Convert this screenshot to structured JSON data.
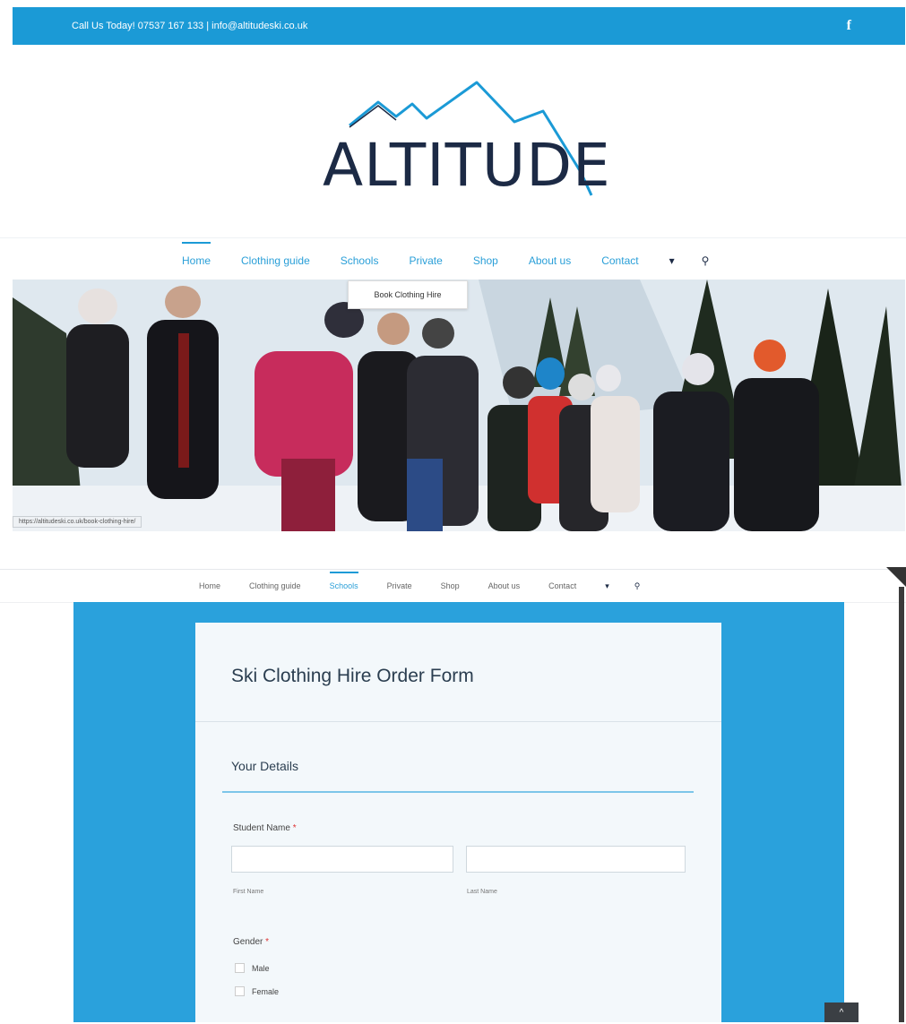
{
  "topbar": {
    "contact_text": "Call Us Today! 07537 167 133 | info@altitudeski.co.uk",
    "facebook_icon": "f"
  },
  "logo": {
    "text": "ALTITUDE"
  },
  "nav": {
    "items": [
      "Home",
      "Clothing guide",
      "Schools",
      "Private",
      "Shop",
      "About us",
      "Contact"
    ],
    "cart_icon": "▾",
    "search_icon": "⚲"
  },
  "dropdown": {
    "item": "Book Clothing Hire"
  },
  "hero": {
    "status_url": "https://altitudeski.co.uk/book-clothing-hire/"
  },
  "nav2": {
    "items": [
      "Home",
      "Clothing guide",
      "Schools",
      "Private",
      "Shop",
      "About us",
      "Contact"
    ],
    "cart_icon": "▾",
    "search_icon": "⚲"
  },
  "form": {
    "title": "Ski Clothing Hire Order Form",
    "section_title": "Your Details",
    "student_name_label": "Student Name",
    "required_mark": "*",
    "first_name_value": "",
    "last_name_value": "",
    "first_name_sublabel": "First Name",
    "last_name_sublabel": "Last Name",
    "gender_label": "Gender",
    "gender_options": [
      "Male",
      "Female"
    ]
  },
  "scroll_top": {
    "icon": "^"
  },
  "colors": {
    "brand_blue": "#1b9ad6",
    "navy": "#1c2a45",
    "form_bg": "#f3f8fb"
  }
}
